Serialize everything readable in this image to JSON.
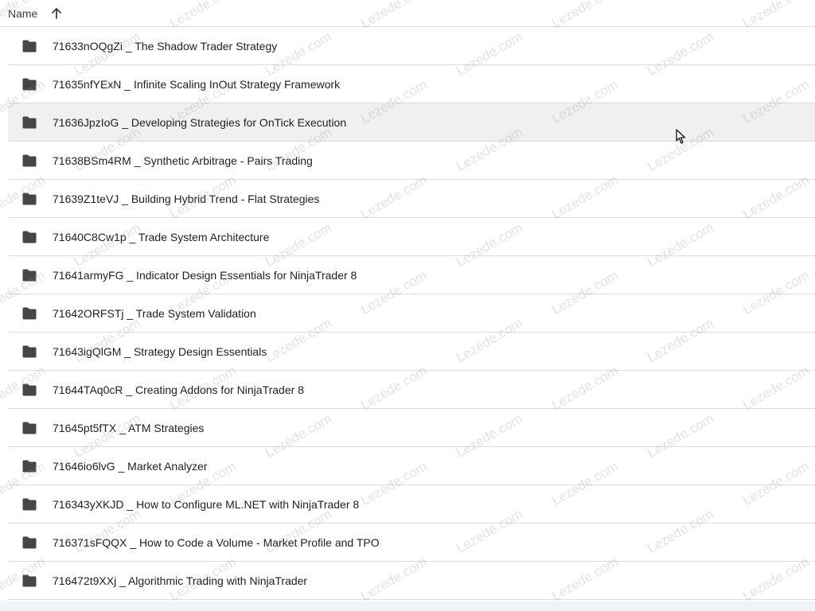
{
  "header": {
    "name_label": "Name",
    "sort_icon": "arrow-up-icon"
  },
  "rows": [
    {
      "label": "71633nOQgZi _ The Shadow Trader Strategy",
      "icon": "folder-icon"
    },
    {
      "label": "71635nfYExN _ Infinite Scaling InOut Strategy Framework",
      "icon": "folder-icon"
    },
    {
      "label": "71636JpzIoG _ Developing Strategies for OnTick Execution",
      "icon": "folder-icon",
      "hovered": true
    },
    {
      "label": "71638BSm4RM _ Synthetic Arbitrage - Pairs Trading",
      "icon": "folder-icon"
    },
    {
      "label": "71639Z1teVJ _ Building Hybrid Trend - Flat Strategies",
      "icon": "folder-icon"
    },
    {
      "label": "71640C8Cw1p _ Trade System Architecture",
      "icon": "folder-icon"
    },
    {
      "label": "71641armyFG _ Indicator Design Essentials for NinjaTrader 8",
      "icon": "folder-icon"
    },
    {
      "label": "71642ORFSTj _ Trade System Validation",
      "icon": "folder-icon"
    },
    {
      "label": "71643igQlGM _ Strategy Design Essentials",
      "icon": "folder-icon"
    },
    {
      "label": "71644TAq0cR _ Creating Addons for NinjaTrader 8",
      "icon": "folder-icon"
    },
    {
      "label": "71645pt5fTX _ ATM Strategies",
      "icon": "folder-icon"
    },
    {
      "label": "71646io6lvG _ Market Analyzer",
      "icon": "folder-icon"
    },
    {
      "label": "716343yXKJD _ How to Configure ML.NET with NinjaTrader 8",
      "icon": "folder-icon"
    },
    {
      "label": "716371sFQQX _ How to Code a Volume - Market Profile and TPO",
      "icon": "folder-icon"
    },
    {
      "label": "716472t9XXj _ Algorithmic Trading with NinjaTrader",
      "icon": "folder-icon"
    }
  ],
  "watermark": "Lezede.com",
  "colors": {
    "divider": "#dadce0",
    "hover_row": "#f0f0f0",
    "folder_icon": "#444746",
    "text": "#1f1f1f"
  }
}
